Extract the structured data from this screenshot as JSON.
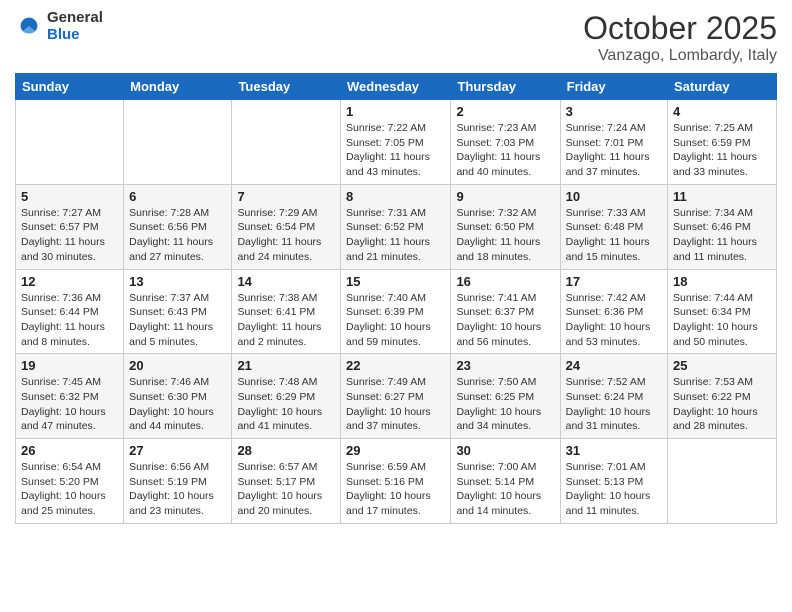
{
  "header": {
    "logo_general": "General",
    "logo_blue": "Blue",
    "month": "October 2025",
    "location": "Vanzago, Lombardy, Italy"
  },
  "days_of_week": [
    "Sunday",
    "Monday",
    "Tuesday",
    "Wednesday",
    "Thursday",
    "Friday",
    "Saturday"
  ],
  "weeks": [
    {
      "days": [
        {
          "number": "",
          "info": ""
        },
        {
          "number": "",
          "info": ""
        },
        {
          "number": "",
          "info": ""
        },
        {
          "number": "1",
          "info": "Sunrise: 7:22 AM\nSunset: 7:05 PM\nDaylight: 11 hours\nand 43 minutes."
        },
        {
          "number": "2",
          "info": "Sunrise: 7:23 AM\nSunset: 7:03 PM\nDaylight: 11 hours\nand 40 minutes."
        },
        {
          "number": "3",
          "info": "Sunrise: 7:24 AM\nSunset: 7:01 PM\nDaylight: 11 hours\nand 37 minutes."
        },
        {
          "number": "4",
          "info": "Sunrise: 7:25 AM\nSunset: 6:59 PM\nDaylight: 11 hours\nand 33 minutes."
        }
      ]
    },
    {
      "days": [
        {
          "number": "5",
          "info": "Sunrise: 7:27 AM\nSunset: 6:57 PM\nDaylight: 11 hours\nand 30 minutes."
        },
        {
          "number": "6",
          "info": "Sunrise: 7:28 AM\nSunset: 6:56 PM\nDaylight: 11 hours\nand 27 minutes."
        },
        {
          "number": "7",
          "info": "Sunrise: 7:29 AM\nSunset: 6:54 PM\nDaylight: 11 hours\nand 24 minutes."
        },
        {
          "number": "8",
          "info": "Sunrise: 7:31 AM\nSunset: 6:52 PM\nDaylight: 11 hours\nand 21 minutes."
        },
        {
          "number": "9",
          "info": "Sunrise: 7:32 AM\nSunset: 6:50 PM\nDaylight: 11 hours\nand 18 minutes."
        },
        {
          "number": "10",
          "info": "Sunrise: 7:33 AM\nSunset: 6:48 PM\nDaylight: 11 hours\nand 15 minutes."
        },
        {
          "number": "11",
          "info": "Sunrise: 7:34 AM\nSunset: 6:46 PM\nDaylight: 11 hours\nand 11 minutes."
        }
      ]
    },
    {
      "days": [
        {
          "number": "12",
          "info": "Sunrise: 7:36 AM\nSunset: 6:44 PM\nDaylight: 11 hours\nand 8 minutes."
        },
        {
          "number": "13",
          "info": "Sunrise: 7:37 AM\nSunset: 6:43 PM\nDaylight: 11 hours\nand 5 minutes."
        },
        {
          "number": "14",
          "info": "Sunrise: 7:38 AM\nSunset: 6:41 PM\nDaylight: 11 hours\nand 2 minutes."
        },
        {
          "number": "15",
          "info": "Sunrise: 7:40 AM\nSunset: 6:39 PM\nDaylight: 10 hours\nand 59 minutes."
        },
        {
          "number": "16",
          "info": "Sunrise: 7:41 AM\nSunset: 6:37 PM\nDaylight: 10 hours\nand 56 minutes."
        },
        {
          "number": "17",
          "info": "Sunrise: 7:42 AM\nSunset: 6:36 PM\nDaylight: 10 hours\nand 53 minutes."
        },
        {
          "number": "18",
          "info": "Sunrise: 7:44 AM\nSunset: 6:34 PM\nDaylight: 10 hours\nand 50 minutes."
        }
      ]
    },
    {
      "days": [
        {
          "number": "19",
          "info": "Sunrise: 7:45 AM\nSunset: 6:32 PM\nDaylight: 10 hours\nand 47 minutes."
        },
        {
          "number": "20",
          "info": "Sunrise: 7:46 AM\nSunset: 6:30 PM\nDaylight: 10 hours\nand 44 minutes."
        },
        {
          "number": "21",
          "info": "Sunrise: 7:48 AM\nSunset: 6:29 PM\nDaylight: 10 hours\nand 41 minutes."
        },
        {
          "number": "22",
          "info": "Sunrise: 7:49 AM\nSunset: 6:27 PM\nDaylight: 10 hours\nand 37 minutes."
        },
        {
          "number": "23",
          "info": "Sunrise: 7:50 AM\nSunset: 6:25 PM\nDaylight: 10 hours\nand 34 minutes."
        },
        {
          "number": "24",
          "info": "Sunrise: 7:52 AM\nSunset: 6:24 PM\nDaylight: 10 hours\nand 31 minutes."
        },
        {
          "number": "25",
          "info": "Sunrise: 7:53 AM\nSunset: 6:22 PM\nDaylight: 10 hours\nand 28 minutes."
        }
      ]
    },
    {
      "days": [
        {
          "number": "26",
          "info": "Sunrise: 6:54 AM\nSunset: 5:20 PM\nDaylight: 10 hours\nand 25 minutes."
        },
        {
          "number": "27",
          "info": "Sunrise: 6:56 AM\nSunset: 5:19 PM\nDaylight: 10 hours\nand 23 minutes."
        },
        {
          "number": "28",
          "info": "Sunrise: 6:57 AM\nSunset: 5:17 PM\nDaylight: 10 hours\nand 20 minutes."
        },
        {
          "number": "29",
          "info": "Sunrise: 6:59 AM\nSunset: 5:16 PM\nDaylight: 10 hours\nand 17 minutes."
        },
        {
          "number": "30",
          "info": "Sunrise: 7:00 AM\nSunset: 5:14 PM\nDaylight: 10 hours\nand 14 minutes."
        },
        {
          "number": "31",
          "info": "Sunrise: 7:01 AM\nSunset: 5:13 PM\nDaylight: 10 hours\nand 11 minutes."
        },
        {
          "number": "",
          "info": ""
        }
      ]
    }
  ]
}
